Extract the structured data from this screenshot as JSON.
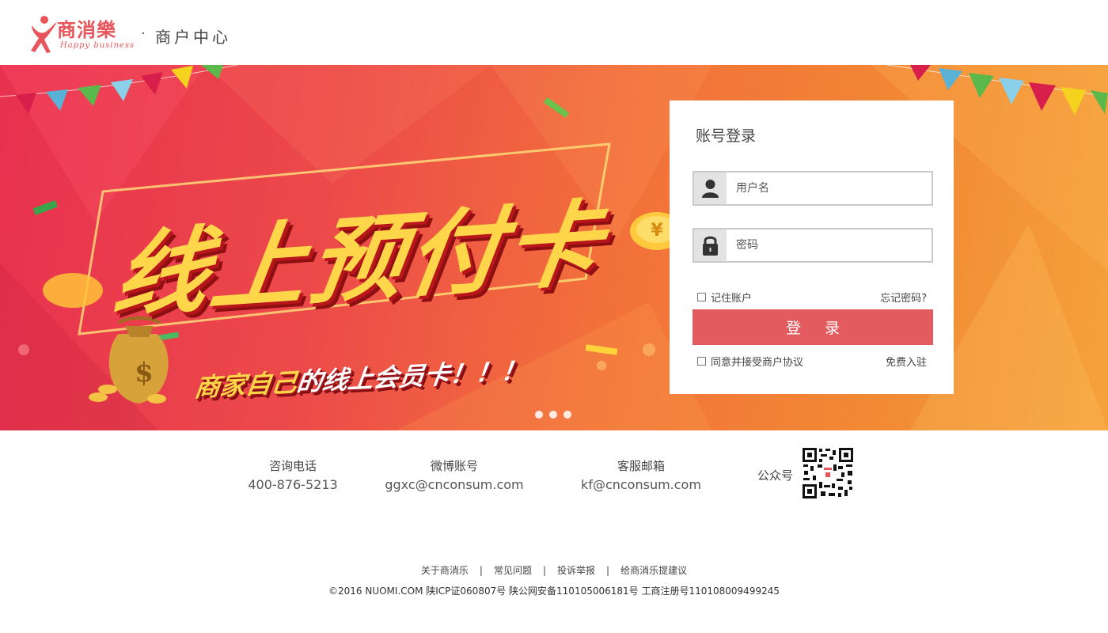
{
  "header": {
    "logo_text": "商消樂",
    "logo_subtext": "Happy business",
    "separator": "·",
    "title": "商户中心"
  },
  "banner": {
    "headline": "线上预付卡",
    "subline_part1": "商家自己",
    "subline_part2": "的线上会员卡！！！",
    "coin_symbol": "¥",
    "dollar_symbol": "$",
    "slide_count": 3,
    "active_slide": 1
  },
  "login": {
    "title": "账号登录",
    "username_placeholder": "用户名",
    "password_placeholder": "密码",
    "remember_label": "记住账户",
    "forgot_label": "忘记密码?",
    "submit_label": "登 录",
    "agree_label": "同意并接受商户协议",
    "signup_label": "免费入驻"
  },
  "contact": {
    "phone_label": "咨询电话",
    "phone_value": "400-876-5213",
    "weibo_label": "微博账号",
    "weibo_value": "ggxc@cnconsum.com",
    "email_label": "客服邮箱",
    "email_value": "kf@cnconsum.com",
    "wechat_label": "公众号"
  },
  "footer": {
    "links": [
      "关于商消乐",
      "常见问题",
      "投诉举报",
      "给商消乐提建议"
    ],
    "separator": "|",
    "copyright": "©2016 NUOMI.COM 陕ICP证060807号 陕公网安备110105006181号 工商注册号110108009499245"
  },
  "colors": {
    "brand": "#e8555a",
    "button": "#e45b5f",
    "banner_start": "#e8304f",
    "banner_end": "#f5a23c",
    "headline": "#ffd54a"
  }
}
